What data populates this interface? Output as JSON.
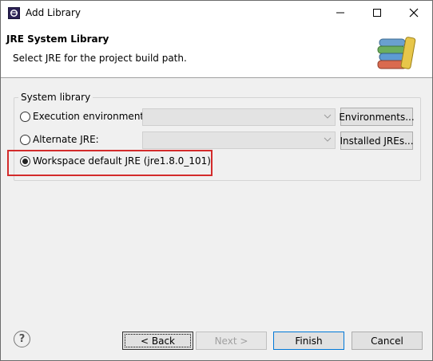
{
  "window": {
    "title": "Add Library"
  },
  "titlebar": {
    "minimize_icon": "minimize-icon",
    "maximize_icon": "maximize-icon",
    "close_icon": "close-icon"
  },
  "banner": {
    "title": "JRE System Library",
    "description": "Select JRE for the project build path.",
    "icon": "library-books-icon"
  },
  "group": {
    "label": "System library",
    "options": [
      {
        "label": "Execution environment:",
        "checked": false,
        "combo_value": "",
        "button": "Environments..."
      },
      {
        "label": "Alternate JRE:",
        "checked": false,
        "combo_value": "",
        "button": "Installed JREs..."
      },
      {
        "label": "Workspace default JRE (jre1.8.0_101)",
        "checked": true
      }
    ]
  },
  "footer": {
    "help_icon": "help-icon",
    "back": "< Back",
    "next": "Next >",
    "finish": "Finish",
    "cancel": "Cancel"
  }
}
